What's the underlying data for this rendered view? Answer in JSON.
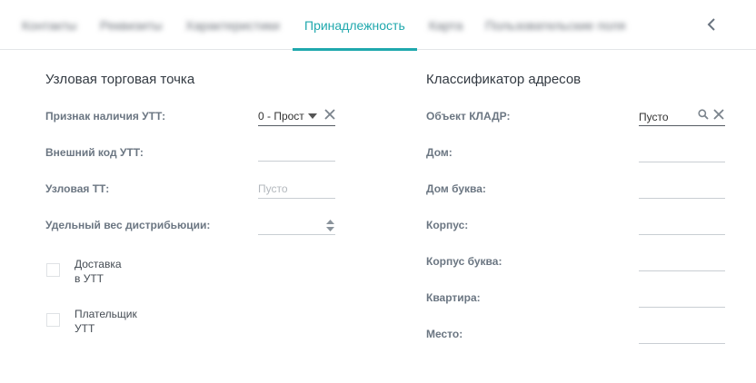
{
  "tabs": [
    {
      "label": "Контакты",
      "blurred": true
    },
    {
      "label": "Реквизиты",
      "blurred": true
    },
    {
      "label": "Характеристики",
      "blurred": true
    },
    {
      "label": "Принадлежность",
      "active": true
    },
    {
      "label": "Карта",
      "blurred": true
    },
    {
      "label": "Пользовательские поля",
      "blurred": true
    }
  ],
  "left": {
    "title": "Узловая торговая точка",
    "fields": {
      "utt_flag": {
        "label": "Признак наличия УТТ:",
        "value": "0 - Прост"
      },
      "ext_code": {
        "label": "Внешний код УТТ:",
        "value": ""
      },
      "node_tt": {
        "label": "Узловая ТТ:",
        "placeholder": "Пусто"
      },
      "dist_weight": {
        "label": "Удельный вес дистрибьюции:",
        "value": ""
      }
    },
    "checkboxes": {
      "delivery": {
        "line1": "Доставка",
        "line2": "в УТТ",
        "checked": false
      },
      "payer": {
        "line1": "Плательщик",
        "line2": "УТТ",
        "checked": false
      }
    }
  },
  "right": {
    "title": "Классификатор адресов",
    "fields": {
      "kladr": {
        "label": "Объект КЛАДР:",
        "value": "Пусто"
      },
      "house": {
        "label": "Дом:",
        "value": ""
      },
      "house_letter": {
        "label": "Дом буква:",
        "value": ""
      },
      "building": {
        "label": "Корпус:",
        "value": ""
      },
      "building_letter": {
        "label": "Корпус буква:",
        "value": ""
      },
      "apartment": {
        "label": "Квартира:",
        "value": ""
      },
      "place": {
        "label": "Место:",
        "value": ""
      }
    }
  },
  "colors": {
    "accent": "#1fa8ad",
    "label": "#6b7682",
    "border": "#c9ced3"
  },
  "icons": {
    "collapse": "chevron-left-icon",
    "clear": "close-icon",
    "dropdown": "caret-down-icon",
    "search": "search-icon",
    "spinner": "spinner-arrows-icon"
  }
}
